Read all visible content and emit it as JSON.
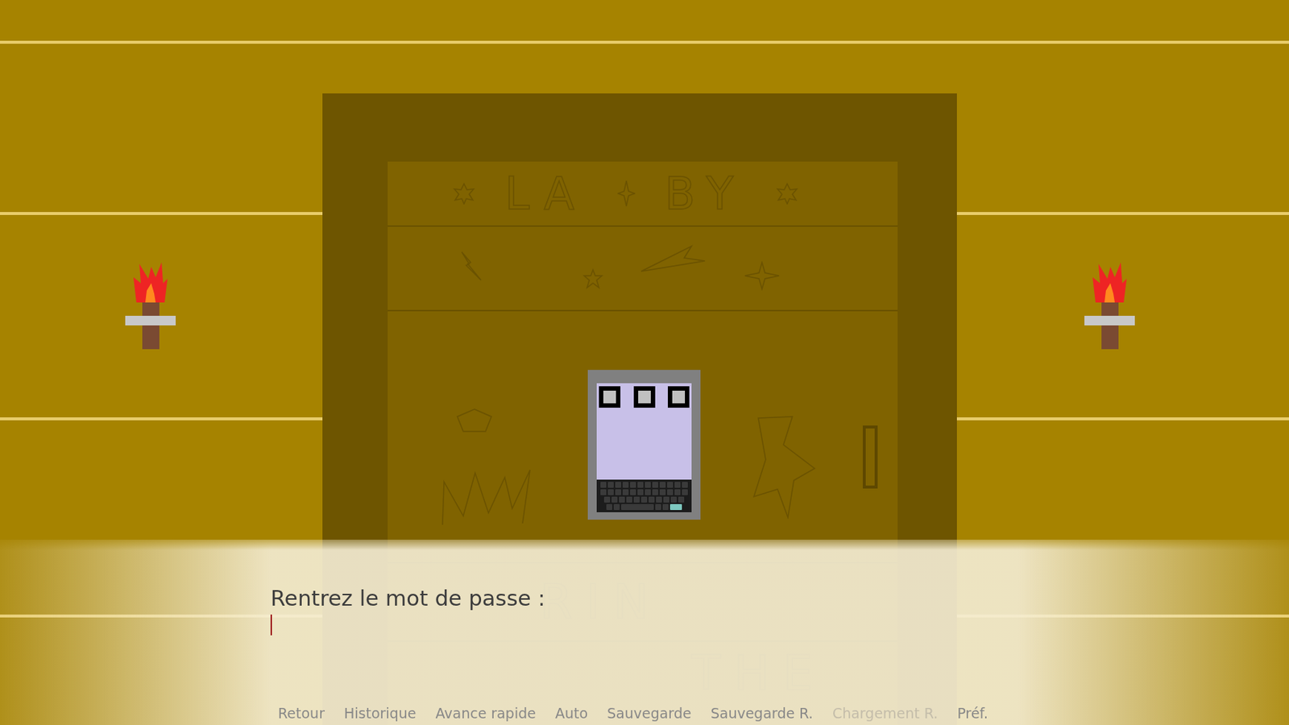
{
  "scene": {
    "door": {
      "top_words": [
        "LA",
        "BY"
      ],
      "lower_words": [
        "RIN",
        "THE"
      ]
    },
    "keypad": {
      "slots": [
        {
          "filled": false
        },
        {
          "filled": false
        },
        {
          "filled": false
        }
      ]
    }
  },
  "dialogue": {
    "prompt": "Rentrez le mot de passe :",
    "input": {
      "value": "",
      "focused": true
    }
  },
  "quick_menu": [
    {
      "label": "Retour",
      "disabled": false
    },
    {
      "label": "Historique",
      "disabled": false
    },
    {
      "label": "Avance rapide",
      "disabled": false
    },
    {
      "label": "Auto",
      "disabled": false
    },
    {
      "label": "Sauvegarde",
      "disabled": false
    },
    {
      "label": "Sauvegarde R.",
      "disabled": false
    },
    {
      "label": "Chargement R.",
      "disabled": true
    },
    {
      "label": "Préf.",
      "disabled": false
    }
  ]
}
